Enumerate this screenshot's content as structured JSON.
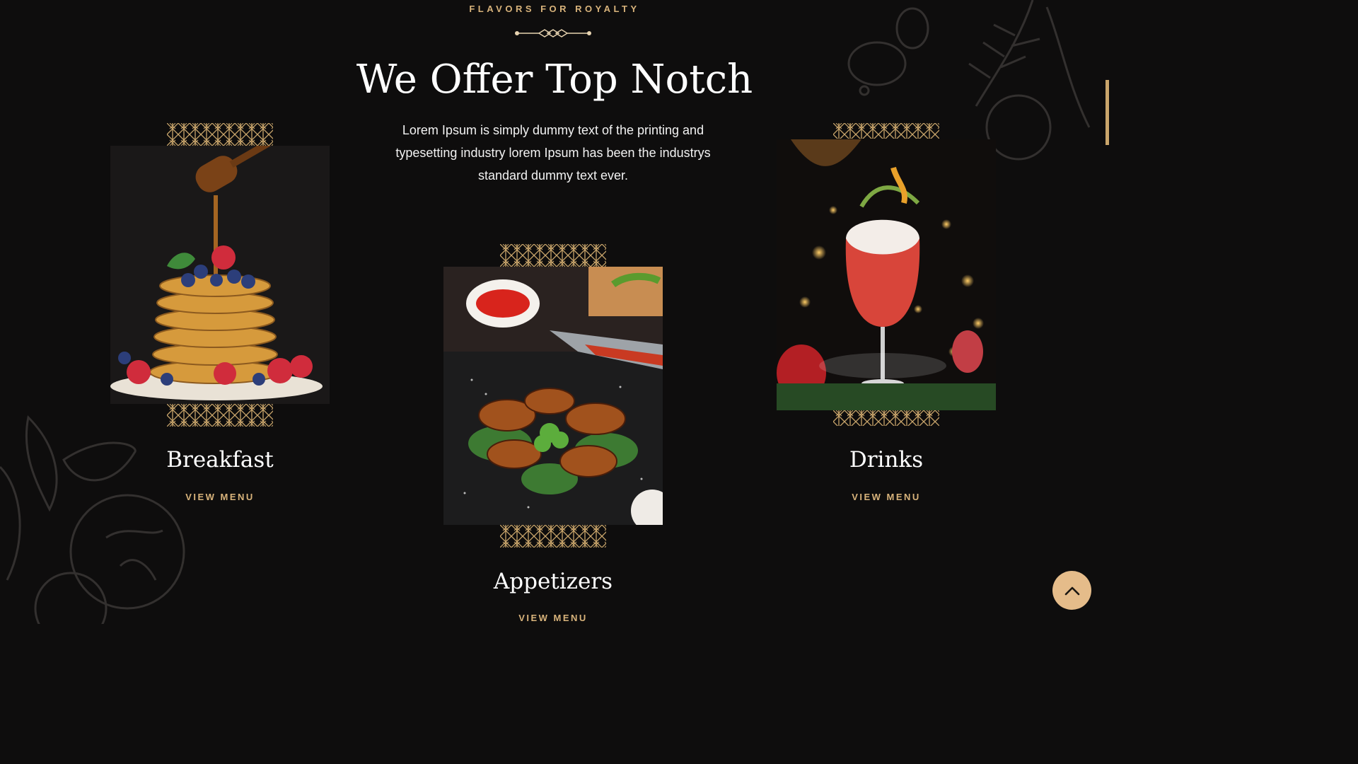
{
  "section": {
    "subtitle": "FLAVORS FOR ROYALTY",
    "heading": "We Offer Top Notch",
    "intro": "Lorem Ipsum is simply dummy text of the printing and typesetting industry lorem Ipsum has been the industrys standard dummy text ever."
  },
  "items": [
    {
      "title": "Breakfast",
      "link": "VIEW MENU",
      "image": "pancakes-photo"
    },
    {
      "title": "Appetizers",
      "link": "VIEW MENU",
      "image": "grilled-wings-photo"
    },
    {
      "title": "Drinks",
      "link": "VIEW MENU",
      "image": "cocktail-photo"
    }
  ],
  "colors": {
    "background": "#0e0d0d",
    "accent": "#d8b37b",
    "button": "#e5bc8a"
  },
  "icons": {
    "scroll_top": "chevron-up-icon",
    "divider": "ornament-divider-icon"
  }
}
